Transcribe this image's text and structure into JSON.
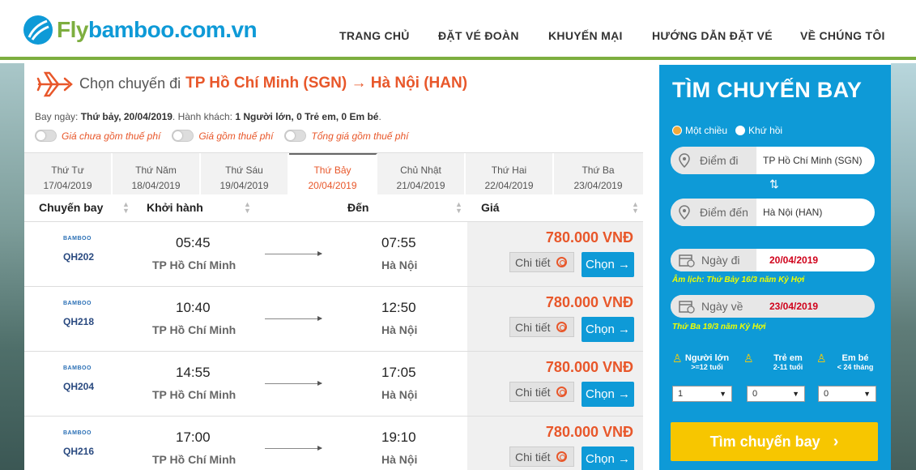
{
  "header": {
    "logo_fly": "Fly",
    "logo_rest": "bamboo.com.vn",
    "nav": [
      "TRANG CHỦ",
      "ĐẶT VÉ ĐOÀN",
      "KHUYẾN MẠI",
      "HƯỚNG DẪN ĐẶT VÉ",
      "VỀ CHÚNG TÔI"
    ]
  },
  "main": {
    "title_prefix": "Chọn chuyến đi",
    "title_route": "TP Hồ Chí Minh (SGN) → Hà Nội (HAN)",
    "info_label_date": "Bay ngày:",
    "info_date": "Thứ bảy, 20/04/2019",
    "info_label_pax": ". Hành khách:",
    "info_pax": "1 Người lớn, 0 Trẻ em, 0 Em bé",
    "info_end": ".",
    "toggles": [
      "Giá chưa gồm thuế phí",
      "Giá gồm thuế phí",
      "Tổng giá gồm thuế phí"
    ],
    "date_tabs": [
      {
        "day": "Thứ Tư",
        "date": "17/04/2019"
      },
      {
        "day": "Thứ Năm",
        "date": "18/04/2019"
      },
      {
        "day": "Thứ Sáu",
        "date": "19/04/2019"
      },
      {
        "day": "Thứ Bảy",
        "date": "20/04/2019"
      },
      {
        "day": "Chủ Nhật",
        "date": "21/04/2019"
      },
      {
        "day": "Thứ Hai",
        "date": "22/04/2019"
      },
      {
        "day": "Thứ Ba",
        "date": "23/04/2019"
      }
    ],
    "active_tab": 3,
    "columns": [
      "Chuyến bay",
      "Khởi hành",
      "Đến",
      "Giá"
    ],
    "flights": [
      {
        "airline": "BAMBOO",
        "code": "QH202",
        "dep_time": "05:45",
        "dep_city": "TP Hồ Chí Minh",
        "arr_time": "07:55",
        "arr_city": "Hà Nội",
        "price": "780.000 VNĐ",
        "detail": "Chi tiết",
        "choose": "Chọn →"
      },
      {
        "airline": "BAMBOO",
        "code": "QH218",
        "dep_time": "10:40",
        "dep_city": "TP Hồ Chí Minh",
        "arr_time": "12:50",
        "arr_city": "Hà Nội",
        "price": "780.000 VNĐ",
        "detail": "Chi tiết",
        "choose": "Chọn →"
      },
      {
        "airline": "BAMBOO",
        "code": "QH204",
        "dep_time": "14:55",
        "dep_city": "TP Hồ Chí Minh",
        "arr_time": "17:05",
        "arr_city": "Hà Nội",
        "price": "780.000 VNĐ",
        "detail": "Chi tiết",
        "choose": "Chọn →"
      },
      {
        "airline": "BAMBOO",
        "code": "QH216",
        "dep_time": "17:00",
        "dep_city": "TP Hồ Chí Minh",
        "arr_time": "19:10",
        "arr_city": "Hà Nội",
        "price": "780.000 VNĐ",
        "detail": "Chi tiết",
        "choose": "Chọn →"
      }
    ]
  },
  "panel": {
    "title": "TÌM CHUYẾN BAY",
    "one_way": "Một chiều",
    "round_trip": "Khứ hồi",
    "from_label": "Điểm đi",
    "from_value": "TP Hồ Chí Minh (SGN)",
    "to_label": "Điểm đến",
    "to_value": "Hà Nội (HAN)",
    "depart_label": "Ngày đi",
    "depart_value": "20/04/2019",
    "depart_lunar": "Âm lịch: Thứ Bảy 16/3 năm Kỷ Hợi",
    "return_label": "Ngày về",
    "return_value": "23/04/2019",
    "return_lunar": "Thứ Ba 19/3 năm Kỷ Hợi",
    "adult_label": "Người lớn",
    "adult_sub": ">=12 tuổi",
    "child_label": "Trẻ em",
    "child_sub": "2-11 tuổi",
    "infant_label": "Em bé",
    "infant_sub": "< 24 tháng",
    "adult_value": "1",
    "child_value": "0",
    "infant_value": "0",
    "search_button": "Tìm chuyến bay"
  },
  "colors": {
    "accent": "#0e9ad7",
    "brand_green": "#7dae3f",
    "price": "#e8572a",
    "search_button": "#f7c600"
  }
}
